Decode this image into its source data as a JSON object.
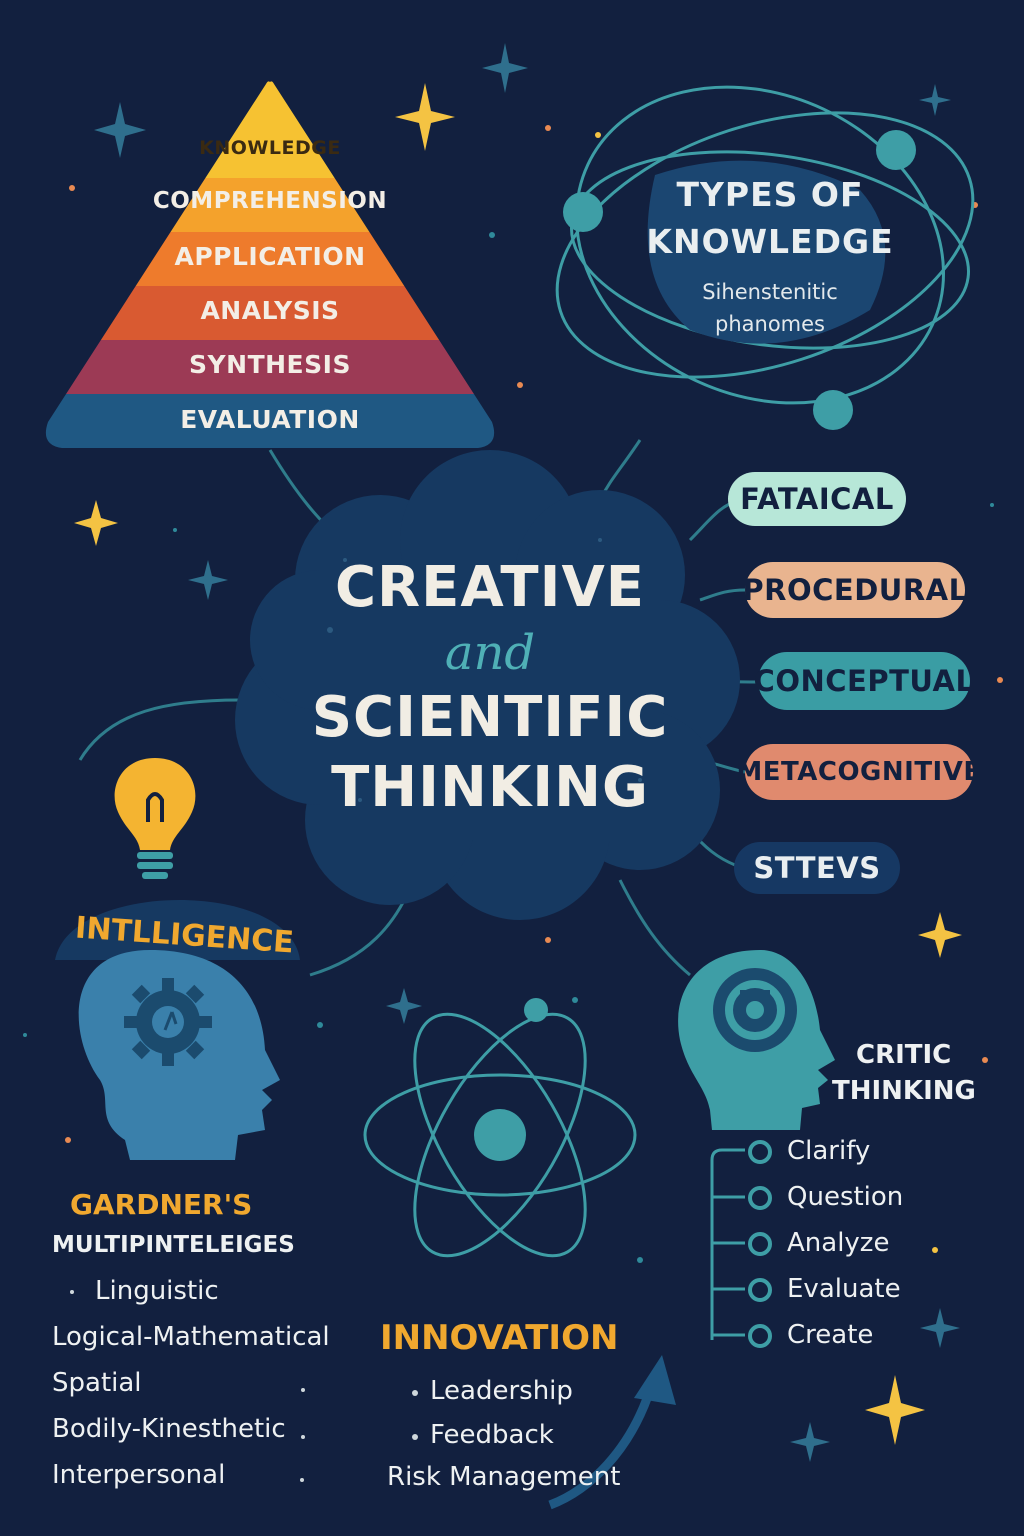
{
  "pyramid": {
    "levels": [
      "KNOWLEDGE",
      "COMPREHENSION",
      "APPLICATION",
      "ANALYSIS",
      "SYNTHESIS",
      "EVALUATION"
    ]
  },
  "types_of_knowledge": {
    "title_line1": "TYPES OF",
    "title_line2": "KNOWLEDGE",
    "subtitle_line1": "Sihenstenitic",
    "subtitle_line2": "phanomes"
  },
  "center": {
    "line1": "CREATIVE",
    "line2": "and",
    "line3": "SCIENTIFIC",
    "line4": "THINKING"
  },
  "knowledge_pills": [
    "FATAICAL",
    "PROCEDURAL",
    "CONCEPTUAL",
    "METACOGNITIVE",
    "STTEVS"
  ],
  "intelligence": {
    "heading": "INTLLIGENCE",
    "gardner_line1": "GARDNER'S",
    "gardner_line2": "MULTIPINTELEIGES",
    "items": [
      "Linguistic",
      "Logical-Mathematical",
      "Spatial",
      "Bodily-Kinesthetic",
      "Interpersonal"
    ]
  },
  "innovation": {
    "heading": "INNOVATION",
    "items": [
      "Leadership",
      "Feedback",
      "Risk Management"
    ]
  },
  "critical_thinking": {
    "heading_line1": "CRITIC",
    "heading_line2": "THINKING",
    "steps": [
      "Clarify",
      "Question",
      "Analyze",
      "Evaluate",
      "Create"
    ]
  },
  "colors": {
    "background": "#12203f",
    "teal": "#3e9ea6",
    "orange": "#f0a82f",
    "pyramid": [
      "#f6c232",
      "#f4a22c",
      "#ee7b2c",
      "#d95a31",
      "#9c3a55",
      "#1f5883"
    ],
    "pills": [
      "#b7e7d8",
      "#e9b48f",
      "#3a9da4",
      "#e08a6e",
      "#163863"
    ]
  }
}
